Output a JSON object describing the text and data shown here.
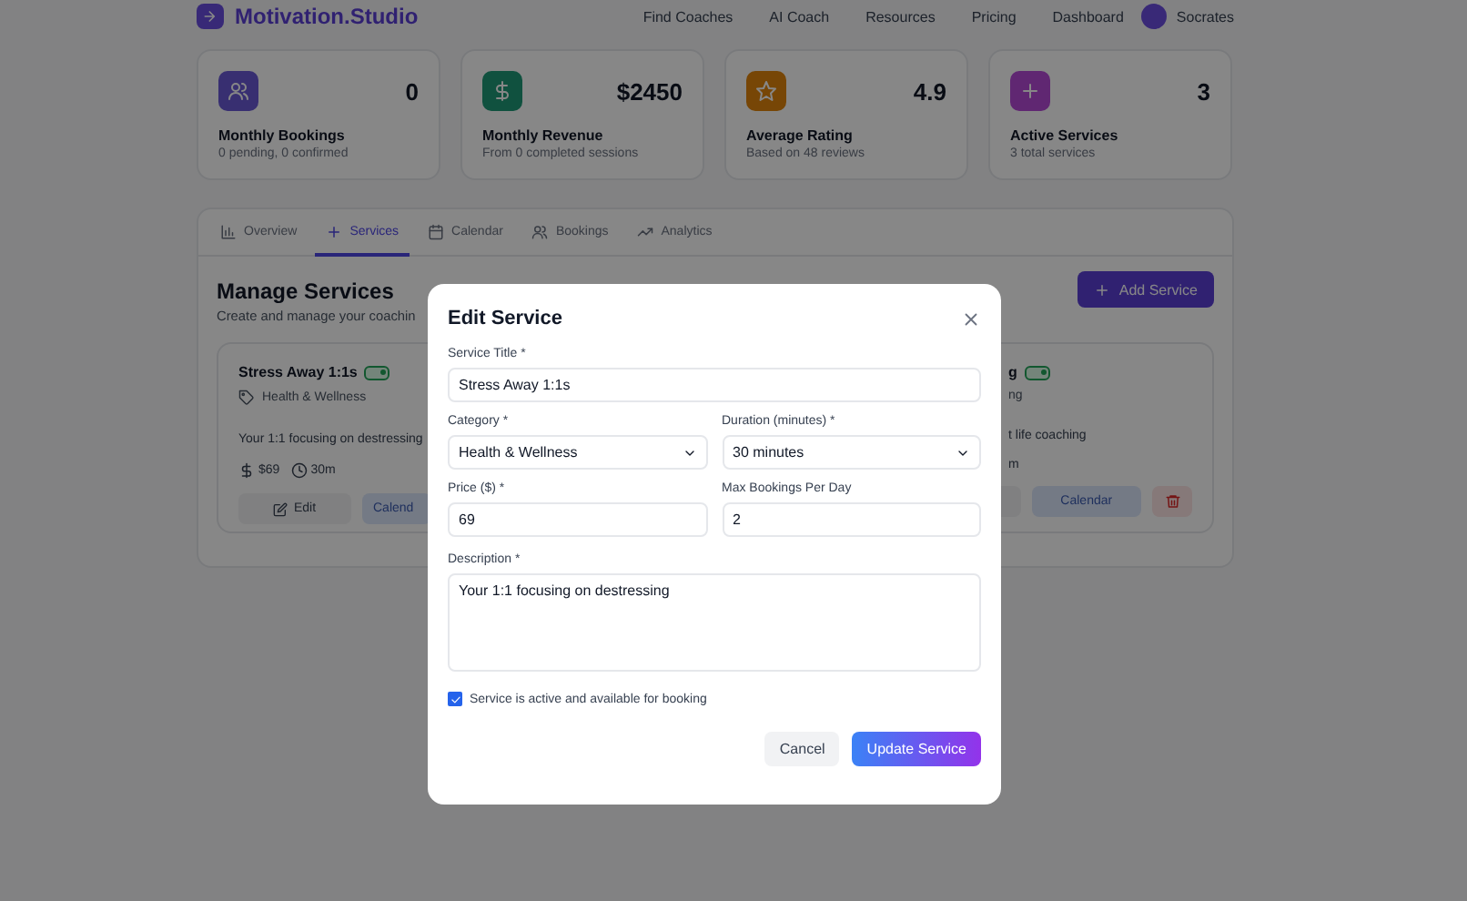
{
  "header": {
    "logo_text": "Motivation.Studio",
    "nav": [
      "Find Coaches",
      "AI Coach",
      "Resources",
      "Pricing",
      "Dashboard"
    ],
    "user_name": "Socrates"
  },
  "stats": [
    {
      "kind": "bookings",
      "value": "0",
      "label": "Monthly Bookings",
      "sub": "0 pending, 0 confirmed"
    },
    {
      "kind": "revenue",
      "value": "$2450",
      "label": "Monthly Revenue",
      "sub": "From 0 completed sessions"
    },
    {
      "kind": "rating",
      "value": "4.9",
      "label": "Average Rating",
      "sub": "Based on 48 reviews"
    },
    {
      "kind": "services",
      "value": "3",
      "label": "Active Services",
      "sub": "3 total services"
    }
  ],
  "tabs": [
    {
      "kind": "overview",
      "label": "Overview",
      "selected": false
    },
    {
      "kind": "services",
      "label": "Services",
      "selected": true
    },
    {
      "kind": "calendar",
      "label": "Calendar",
      "selected": false
    },
    {
      "kind": "bookings",
      "label": "Bookings",
      "selected": false
    },
    {
      "kind": "analytics",
      "label": "Analytics",
      "selected": false
    }
  ],
  "services": {
    "title": "Manage Services",
    "subtitle": "Create and manage your coachin",
    "add_button": "Add Service",
    "card_left": {
      "title": "Stress Away 1:1s",
      "active": true,
      "category": "Health & Wellness",
      "description": "Your 1:1 focusing on destressing",
      "price": "$69",
      "duration": "30m",
      "edit_button": "Edit",
      "calendar_button": "Calend"
    },
    "card_right": {
      "title": "g",
      "active": true,
      "category": "ng",
      "description": "t life coaching",
      "duration": "m",
      "calendar_button": "Calendar"
    }
  },
  "modal": {
    "title": "Edit Service",
    "service_title": {
      "label": "Service Title *",
      "value": "Stress Away 1:1s"
    },
    "category": {
      "label": "Category *",
      "value": "Health & Wellness"
    },
    "duration": {
      "label": "Duration (minutes) *",
      "value": "30 minutes"
    },
    "price": {
      "label": "Price ($) *",
      "value": "69"
    },
    "max_bookings": {
      "label": "Max Bookings Per Day",
      "value": "2"
    },
    "description": {
      "label": "Description *",
      "value": "Your 1:1 focusing on destressing"
    },
    "active_checkbox": {
      "label": "Service is active and available for booking",
      "checked": true
    },
    "cancel_button": "Cancel",
    "update_button": "Update Service"
  }
}
